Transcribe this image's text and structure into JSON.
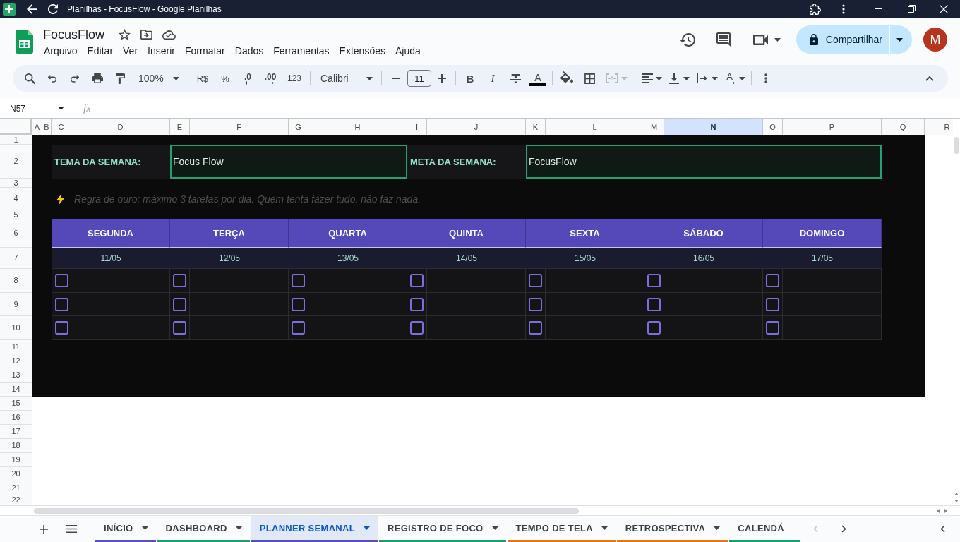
{
  "browser": {
    "title": "Planilhas - FocusFlow - Google Planilhas"
  },
  "document": {
    "title": "FocusFlow"
  },
  "menu": [
    "Arquivo",
    "Editar",
    "Ver",
    "Inserir",
    "Formatar",
    "Dados",
    "Ferramentas",
    "Extensões",
    "Ajuda"
  ],
  "share_button": {
    "label": "Compartilhar"
  },
  "avatar": {
    "initial": "M"
  },
  "toolbar": {
    "zoom": "100%",
    "currency": "R$",
    "percent": "%",
    "decrease_decimals": ".0",
    "increase_decimals": ".00",
    "number_format": "123",
    "font": "Calibri",
    "font_size": "11",
    "bold": "B",
    "italic": "I",
    "text_color": "A",
    "text_rotation": "A",
    "merge_disabled": true
  },
  "formula_bar": {
    "name_box": "N57",
    "function_label": "fx"
  },
  "columns": [
    {
      "label": "A",
      "selected": false
    },
    {
      "label": "B",
      "selected": false
    },
    {
      "label": "C",
      "selected": false
    },
    {
      "label": "D",
      "selected": false
    },
    {
      "label": "E",
      "selected": false
    },
    {
      "label": "F",
      "selected": false
    },
    {
      "label": "G",
      "selected": false
    },
    {
      "label": "H",
      "selected": false
    },
    {
      "label": "I",
      "selected": false
    },
    {
      "label": "J",
      "selected": false
    },
    {
      "label": "K",
      "selected": false
    },
    {
      "label": "L",
      "selected": false
    },
    {
      "label": "M",
      "selected": false
    },
    {
      "label": "N",
      "selected": true
    },
    {
      "label": "O",
      "selected": false
    },
    {
      "label": "P",
      "selected": false
    },
    {
      "label": "Q",
      "selected": false
    },
    {
      "label": "R",
      "selected": false
    }
  ],
  "row_numbers": [
    "1",
    "2",
    "3",
    "4",
    "5",
    "6",
    "7",
    "8",
    "9",
    "10",
    "11",
    "12",
    "13",
    "14",
    "15",
    "16",
    "17",
    "18",
    "19",
    "20",
    "21",
    "22"
  ],
  "planner": {
    "theme": {
      "label": "TEMA DA SEMANA:",
      "value": "Focus Flow"
    },
    "goal": {
      "label": "META DA SEMANA:",
      "value": "FocusFlow"
    },
    "rule": "Regra de ouro: máximo 3 tarefas por dia. Quem tenta fazer tudo, não faz nada.",
    "days": [
      {
        "name": "SEGUNDA",
        "date": "11/05",
        "tasks": [
          {
            "checked": false
          },
          {
            "checked": false
          },
          {
            "checked": false
          }
        ]
      },
      {
        "name": "TERÇA",
        "date": "12/05",
        "tasks": [
          {
            "checked": false
          },
          {
            "checked": false
          },
          {
            "checked": false
          }
        ]
      },
      {
        "name": "QUARTA",
        "date": "13/05",
        "tasks": [
          {
            "checked": false
          },
          {
            "checked": false
          },
          {
            "checked": false
          }
        ]
      },
      {
        "name": "QUINTA",
        "date": "14/05",
        "tasks": [
          {
            "checked": false
          },
          {
            "checked": false
          },
          {
            "checked": false
          }
        ]
      },
      {
        "name": "SEXTA",
        "date": "15/05",
        "tasks": [
          {
            "checked": false
          },
          {
            "checked": false
          },
          {
            "checked": false
          }
        ]
      },
      {
        "name": "SÁBADO",
        "date": "16/05",
        "tasks": [
          {
            "checked": false
          },
          {
            "checked": false
          },
          {
            "checked": false
          }
        ]
      },
      {
        "name": "DOMINGO",
        "date": "17/05",
        "tasks": [
          {
            "checked": false
          },
          {
            "checked": false
          },
          {
            "checked": false
          }
        ]
      }
    ]
  },
  "sheet_tabs": [
    {
      "label": "INÍCIO",
      "selected": false,
      "color": "#5b4fc0",
      "menu_arrow": true
    },
    {
      "label": "DASHBOARD",
      "selected": false,
      "color": "#16a36b",
      "menu_arrow": true
    },
    {
      "label": "PLANNER SEMANAL",
      "selected": true,
      "color": "#5b4fc0",
      "menu_arrow": true
    },
    {
      "label": "REGISTRO DE FOCO",
      "selected": false,
      "color": "#16a36b",
      "menu_arrow": true
    },
    {
      "label": "TEMPO DE TELA",
      "selected": false,
      "color": "#e07a10",
      "menu_arrow": true
    },
    {
      "label": "RETROSPECTIVA",
      "selected": false,
      "color": "#e07a10",
      "menu_arrow": true
    },
    {
      "label": "CALENDÁ",
      "selected": false,
      "color": "#16a36b",
      "menu_arrow": false
    }
  ]
}
